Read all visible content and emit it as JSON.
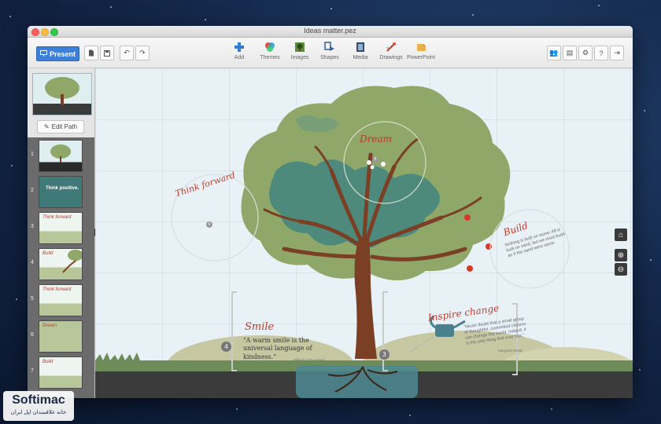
{
  "window": {
    "title": "Ideas matter.pez"
  },
  "toolbar": {
    "present_label": "Present",
    "tools": [
      {
        "label": "Add",
        "icon": "plus-icon"
      },
      {
        "label": "Themes",
        "icon": "themes-icon"
      },
      {
        "label": "Images",
        "icon": "images-icon"
      },
      {
        "label": "Shapes",
        "icon": "shapes-icon"
      },
      {
        "label": "Media",
        "icon": "media-icon"
      },
      {
        "label": "Drawings",
        "icon": "drawings-icon"
      },
      {
        "label": "PowerPoint",
        "icon": "powerpoint-icon"
      }
    ]
  },
  "sidebar": {
    "edit_path_label": "Edit Path",
    "slides": [
      {
        "num": "1",
        "label": ""
      },
      {
        "num": "2",
        "label": "Think positive."
      },
      {
        "num": "3",
        "label": "Think forward"
      },
      {
        "num": "4",
        "label": "Build"
      },
      {
        "num": "5",
        "label": "Think forward"
      },
      {
        "num": "6",
        "label": "Dream"
      },
      {
        "num": "7",
        "label": "Build"
      }
    ]
  },
  "canvas": {
    "dream": {
      "title": "Dream",
      "num": "6"
    },
    "think_forward": {
      "title": "Think forward",
      "num": "5"
    },
    "build": {
      "title": "Build",
      "text": "Nothing is built on stone; All is built on sand, but we must build as if the sand were stone.",
      "author": "Jorge Luis Borges"
    },
    "smile": {
      "title": "Smile",
      "num": "4",
      "quote": "\"A warm smile is the universal language of kindness.\"",
      "author": "William Arthur Ward"
    },
    "inspire": {
      "title": "Inspire change",
      "num": "3",
      "text": "\"Never doubt that a small group of thoughtful, committed citizens can change the world. Indeed, it is the only thing that ever has.\"",
      "author": "Margaret Mead"
    }
  },
  "watermark": {
    "brand": "Softimac",
    "tagline": "خانه علاقمندان اپل ایران"
  },
  "colors": {
    "accent": "#3d7fd6",
    "title_red": "#c0392b",
    "foliage": "#8fa86a",
    "foliage_dark": "#4e8a7c",
    "trunk": "#7a3f24"
  }
}
